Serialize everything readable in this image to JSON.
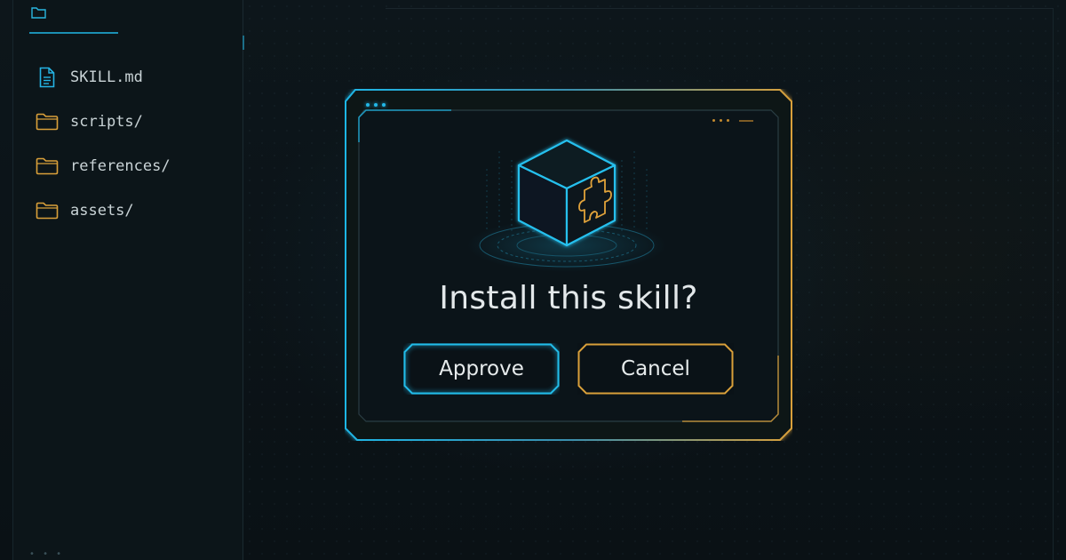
{
  "sidebar": {
    "files": [
      {
        "name": "SKILL.md",
        "icon": "document-icon"
      },
      {
        "name": "scripts/",
        "icon": "folder-icon"
      },
      {
        "name": "references/",
        "icon": "folder-icon"
      },
      {
        "name": "assets/",
        "icon": "folder-icon"
      }
    ]
  },
  "dialog": {
    "title": "Install this skill?",
    "approve_label": "Approve",
    "cancel_label": "Cancel",
    "icon": "skill-cube-puzzle-icon"
  },
  "colors": {
    "accent_cyan": "#1fb6e6",
    "accent_amber": "#d9a03a",
    "background": "#0b1216",
    "text": "#e3e8ea"
  }
}
